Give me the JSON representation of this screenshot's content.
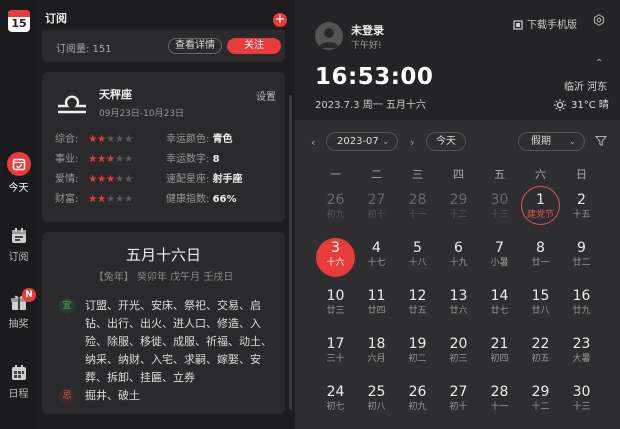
{
  "app_icon": {
    "number": "15"
  },
  "rail": {
    "items": [
      {
        "label": "今天",
        "icon": "calendar-today-icon",
        "active": true
      },
      {
        "label": "订阅",
        "icon": "calendar-subscribe-icon"
      },
      {
        "label": "抽奖",
        "icon": "gift-icon",
        "badge": "N"
      },
      {
        "label": "日程",
        "icon": "calendar-grid-icon"
      }
    ]
  },
  "subscription": {
    "title": "订阅",
    "count_text": "订阅量: 151",
    "detail_label": "查看详情",
    "follow_label": "关注"
  },
  "horoscope": {
    "name": "天秤座",
    "range": "09月23日-10月23日",
    "setting_label": "设置",
    "ratings": [
      {
        "label": "综合:",
        "stars": 2
      },
      {
        "label": "事业:",
        "stars": 3
      },
      {
        "label": "爱情:",
        "stars": 3
      },
      {
        "label": "财富:",
        "stars": 2
      }
    ],
    "facts": [
      {
        "label": "幸运颜色:",
        "value": "青色"
      },
      {
        "label": "幸运数字:",
        "value": "8"
      },
      {
        "label": "速配星座:",
        "value": "射手座"
      },
      {
        "label": "健康指数:",
        "value": "66%"
      }
    ]
  },
  "almanac": {
    "lunar_date": "五月十六日",
    "ganzhi": "【兔年】 癸卯年 戊午月 壬戌日",
    "yi_label": "宜",
    "yi": "订盟、开光、安床、祭祀、交易、启钻、出行、出火、进人口、修造、入殓、除服、移徙、成服、祈福、动土、纳采、纳财、入宅、求嗣、嫁娶、安葬、拆卸、挂匾、立券",
    "ji_label": "忌",
    "ji": "掘井、破土"
  },
  "user": {
    "status": "未登录",
    "greeting": "下午好!",
    "download_label": "下载手机版"
  },
  "now": {
    "time": "16:53:00",
    "date_line": "2023.7.3 周一 五月十六",
    "location": "临沂 河东",
    "weather": "31°C 晴"
  },
  "calendar": {
    "month": "2023-07",
    "today_label": "今天",
    "holiday_label": "假期",
    "weekdays": [
      "一",
      "二",
      "三",
      "四",
      "五",
      "六",
      "日"
    ],
    "weeks": [
      [
        {
          "d": "26",
          "l": "初九",
          "other": true
        },
        {
          "d": "27",
          "l": "初十",
          "other": true
        },
        {
          "d": "28",
          "l": "十一",
          "other": true
        },
        {
          "d": "29",
          "l": "十二",
          "other": true
        },
        {
          "d": "30",
          "l": "十三",
          "other": true
        },
        {
          "d": "1",
          "l": "建党节",
          "holiday": true
        },
        {
          "d": "2",
          "l": "十五"
        }
      ],
      [
        {
          "d": "3",
          "l": "十六",
          "today": true
        },
        {
          "d": "4",
          "l": "十七"
        },
        {
          "d": "5",
          "l": "十八"
        },
        {
          "d": "6",
          "l": "十九"
        },
        {
          "d": "7",
          "l": "小暑"
        },
        {
          "d": "8",
          "l": "廿一"
        },
        {
          "d": "9",
          "l": "廿二"
        }
      ],
      [
        {
          "d": "10",
          "l": "廿三"
        },
        {
          "d": "11",
          "l": "廿四"
        },
        {
          "d": "12",
          "l": "廿五"
        },
        {
          "d": "13",
          "l": "廿六"
        },
        {
          "d": "14",
          "l": "廿七"
        },
        {
          "d": "15",
          "l": "廿八"
        },
        {
          "d": "16",
          "l": "廿九"
        }
      ],
      [
        {
          "d": "17",
          "l": "三十"
        },
        {
          "d": "18",
          "l": "六月"
        },
        {
          "d": "19",
          "l": "初二"
        },
        {
          "d": "20",
          "l": "初三"
        },
        {
          "d": "21",
          "l": "初四"
        },
        {
          "d": "22",
          "l": "初五"
        },
        {
          "d": "23",
          "l": "大暑"
        }
      ],
      [
        {
          "d": "24",
          "l": "初七"
        },
        {
          "d": "25",
          "l": "初八"
        },
        {
          "d": "26",
          "l": "初九"
        },
        {
          "d": "27",
          "l": "初十"
        },
        {
          "d": "28",
          "l": "十一"
        },
        {
          "d": "29",
          "l": "十二"
        },
        {
          "d": "30",
          "l": "十三"
        }
      ]
    ]
  },
  "colors": {
    "accent": "#e83c3c",
    "yi": "#4caf50",
    "ji": "#e05555"
  }
}
